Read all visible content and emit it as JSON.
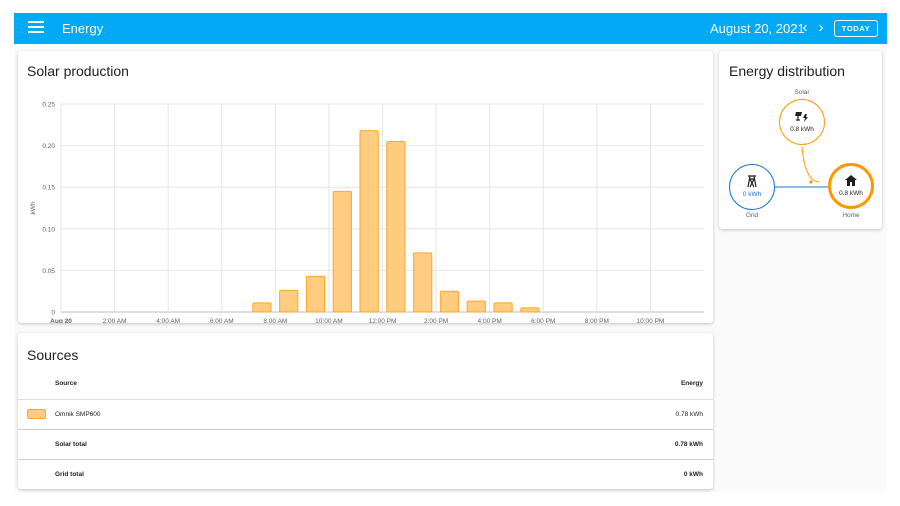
{
  "header": {
    "title": "Energy",
    "date": "August 20, 2021",
    "prev_icon": "chevron-left-icon",
    "next_icon": "chevron-right-icon",
    "today_label": "TODAY",
    "menu_icon": "hamburger-menu-icon",
    "color": "#03a9f4"
  },
  "solar": {
    "title": "Solar production"
  },
  "chart_data": {
    "type": "bar",
    "title": "Solar production",
    "ylabel": "kWh",
    "ylim": [
      0,
      0.25
    ],
    "yticks": [
      "0.25",
      "0.20",
      "0.15",
      "0.10",
      "0.05",
      "0"
    ],
    "xticks": [
      "Aug 20",
      "2:00 AM",
      "4:00 AM",
      "6:00 AM",
      "8:00 AM",
      "10:00 AM",
      "12:00 PM",
      "2:00 PM",
      "4:00 PM",
      "6:00 PM",
      "8:00 PM",
      "10:00 PM"
    ],
    "hours": [
      7,
      8,
      9,
      10,
      11,
      12,
      13,
      14,
      15,
      16,
      17
    ],
    "values": [
      0.011,
      0.026,
      0.043,
      0.145,
      0.218,
      0.205,
      0.071,
      0.025,
      0.013,
      0.011,
      0.005
    ],
    "bar_fill": "#ffcc80",
    "bar_stroke": "#ffa726",
    "grid": true
  },
  "distribution": {
    "title": "Energy distribution",
    "solar": {
      "label": "Solar",
      "value": "0.8 kWh",
      "icon": "solar-power-icon",
      "color": "#ff9800"
    },
    "grid": {
      "label": "Grid",
      "value": "0 kWh",
      "icon": "transmission-tower-icon",
      "color": "#1976d2"
    },
    "home": {
      "label": "Home",
      "value": "0.8 kWh",
      "icon": "home-icon",
      "color": "#ff9800"
    }
  },
  "sources": {
    "title": "Sources",
    "col_source": "Source",
    "col_energy": "Energy",
    "rows": [
      {
        "name": "Omnik SMP600",
        "energy": "0.78 kWh"
      }
    ],
    "solar_total_label": "Solar total",
    "solar_total_value": "0.78 kWh",
    "grid_total_label": "Grid total",
    "grid_total_value": "0 kWh"
  }
}
